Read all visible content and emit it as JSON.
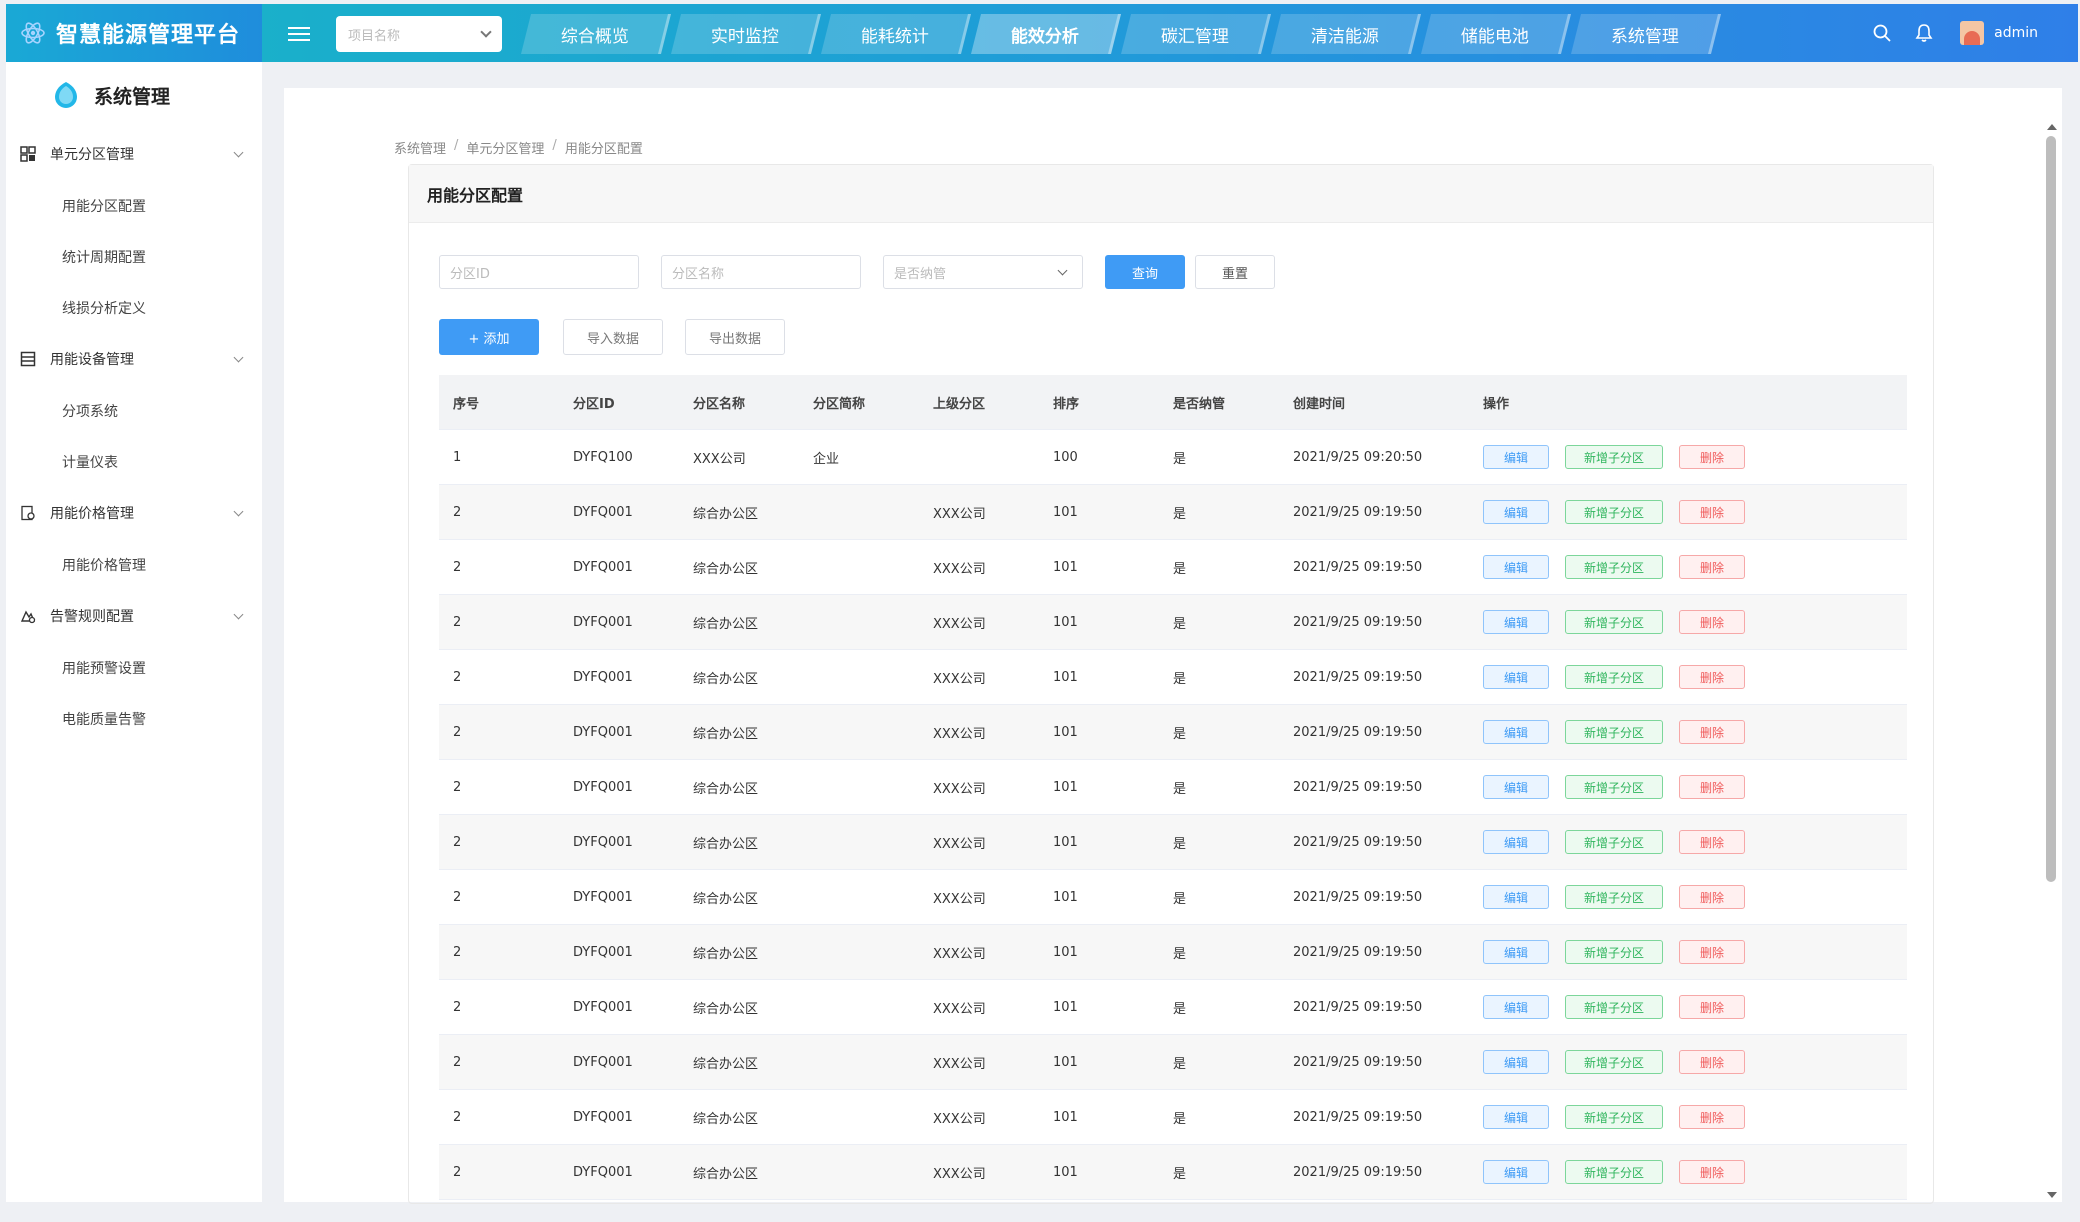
{
  "brand": {
    "title": "智慧能源管理平台"
  },
  "header": {
    "project_placeholder": "项目名称",
    "nav": [
      {
        "label": "综合概览"
      },
      {
        "label": "实时监控"
      },
      {
        "label": "能耗统计"
      },
      {
        "label": "能效分析",
        "active": true
      },
      {
        "label": "碳汇管理"
      },
      {
        "label": "清洁能源"
      },
      {
        "label": "储能电池"
      },
      {
        "label": "系统管理"
      }
    ],
    "user": "admin"
  },
  "sidebar": {
    "title": "系统管理",
    "groups": [
      {
        "label": "单元分区管理",
        "items": [
          "用能分区配置",
          "统计周期配置",
          "线损分析定义"
        ]
      },
      {
        "label": "用能设备管理",
        "items": [
          "分项系统",
          "计量仪表"
        ]
      },
      {
        "label": "用能价格管理",
        "items": [
          "用能价格管理"
        ]
      },
      {
        "label": "告警规则配置",
        "items": [
          "用能预警设置",
          "电能质量告警"
        ]
      }
    ]
  },
  "breadcrumb": [
    "系统管理",
    "单元分区管理",
    "用能分区配置"
  ],
  "panel": {
    "title": "用能分区配置",
    "filters": {
      "id_placeholder": "分区ID",
      "name_placeholder": "分区名称",
      "managed_placeholder": "是否纳管",
      "query": "查询",
      "reset": "重置"
    },
    "actions": {
      "add": "+ 添加",
      "import": "导入数据",
      "export": "导出数据"
    },
    "table": {
      "columns": [
        "序号",
        "分区ID",
        "分区名称",
        "分区简称",
        "上级分区",
        "排序",
        "是否纳管",
        "创建时间",
        "操作"
      ],
      "row_ops": {
        "edit": "编辑",
        "add_child": "新增子分区",
        "delete": "删除"
      },
      "rows": [
        [
          "1",
          "DYFQ100",
          "XXX公司",
          "企业",
          "",
          "100",
          "是",
          "2021/9/25 09:20:50"
        ],
        [
          "2",
          "DYFQ001",
          "综合办公区",
          "",
          "XXX公司",
          "101",
          "是",
          "2021/9/25 09:19:50"
        ],
        [
          "2",
          "DYFQ001",
          "综合办公区",
          "",
          "XXX公司",
          "101",
          "是",
          "2021/9/25 09:19:50"
        ],
        [
          "2",
          "DYFQ001",
          "综合办公区",
          "",
          "XXX公司",
          "101",
          "是",
          "2021/9/25 09:19:50"
        ],
        [
          "2",
          "DYFQ001",
          "综合办公区",
          "",
          "XXX公司",
          "101",
          "是",
          "2021/9/25 09:19:50"
        ],
        [
          "2",
          "DYFQ001",
          "综合办公区",
          "",
          "XXX公司",
          "101",
          "是",
          "2021/9/25 09:19:50"
        ],
        [
          "2",
          "DYFQ001",
          "综合办公区",
          "",
          "XXX公司",
          "101",
          "是",
          "2021/9/25 09:19:50"
        ],
        [
          "2",
          "DYFQ001",
          "综合办公区",
          "",
          "XXX公司",
          "101",
          "是",
          "2021/9/25 09:19:50"
        ],
        [
          "2",
          "DYFQ001",
          "综合办公区",
          "",
          "XXX公司",
          "101",
          "是",
          "2021/9/25 09:19:50"
        ],
        [
          "2",
          "DYFQ001",
          "综合办公区",
          "",
          "XXX公司",
          "101",
          "是",
          "2021/9/25 09:19:50"
        ],
        [
          "2",
          "DYFQ001",
          "综合办公区",
          "",
          "XXX公司",
          "101",
          "是",
          "2021/9/25 09:19:50"
        ],
        [
          "2",
          "DYFQ001",
          "综合办公区",
          "",
          "XXX公司",
          "101",
          "是",
          "2021/9/25 09:19:50"
        ],
        [
          "2",
          "DYFQ001",
          "综合办公区",
          "",
          "XXX公司",
          "101",
          "是",
          "2021/9/25 09:19:50"
        ],
        [
          "2",
          "DYFQ001",
          "综合办公区",
          "",
          "XXX公司",
          "101",
          "是",
          "2021/9/25 09:19:50"
        ]
      ]
    }
  },
  "colors": {
    "primary": "#3f9bf5",
    "success": "#2fb55d",
    "danger": "#f05b5b"
  },
  "icons": {
    "brand": "atom-icon",
    "menu": "menu-fold-icon",
    "search": "search-icon",
    "bell": "bell-icon",
    "sidebar_head": "drop-icon",
    "groups": [
      "grid-icon",
      "list-icon",
      "price-tag-icon",
      "alarm-icon"
    ]
  }
}
